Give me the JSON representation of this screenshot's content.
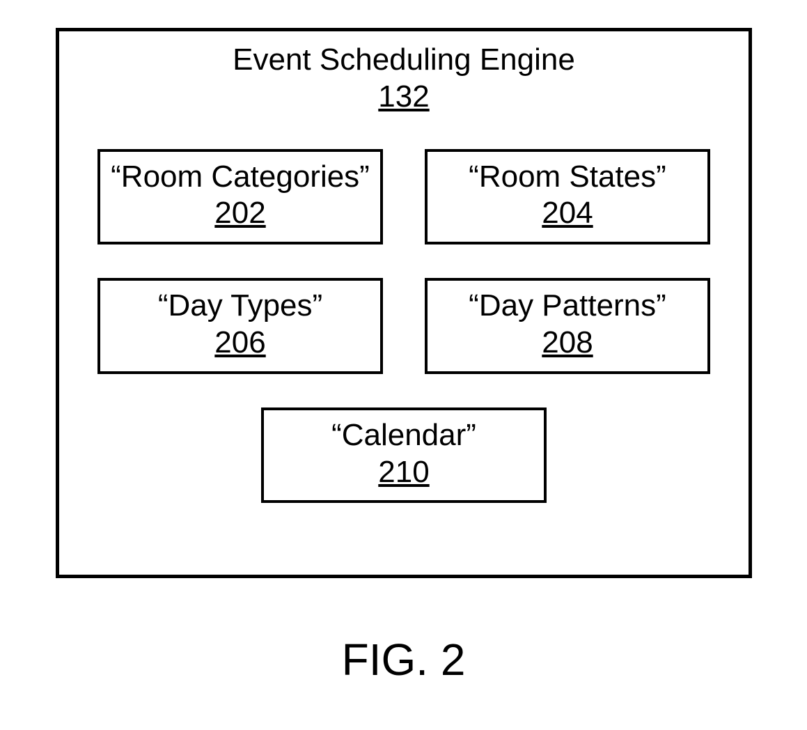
{
  "main": {
    "title": "Event Scheduling Engine",
    "ref": "132",
    "modules": [
      {
        "label": "“Room Categories”",
        "ref": "202"
      },
      {
        "label": "“Room States”",
        "ref": "204"
      },
      {
        "label": "“Day Types”",
        "ref": "206"
      },
      {
        "label": "“Day Patterns”",
        "ref": "208"
      },
      {
        "label": "“Calendar”",
        "ref": "210"
      }
    ]
  },
  "figure_label": "FIG. 2"
}
